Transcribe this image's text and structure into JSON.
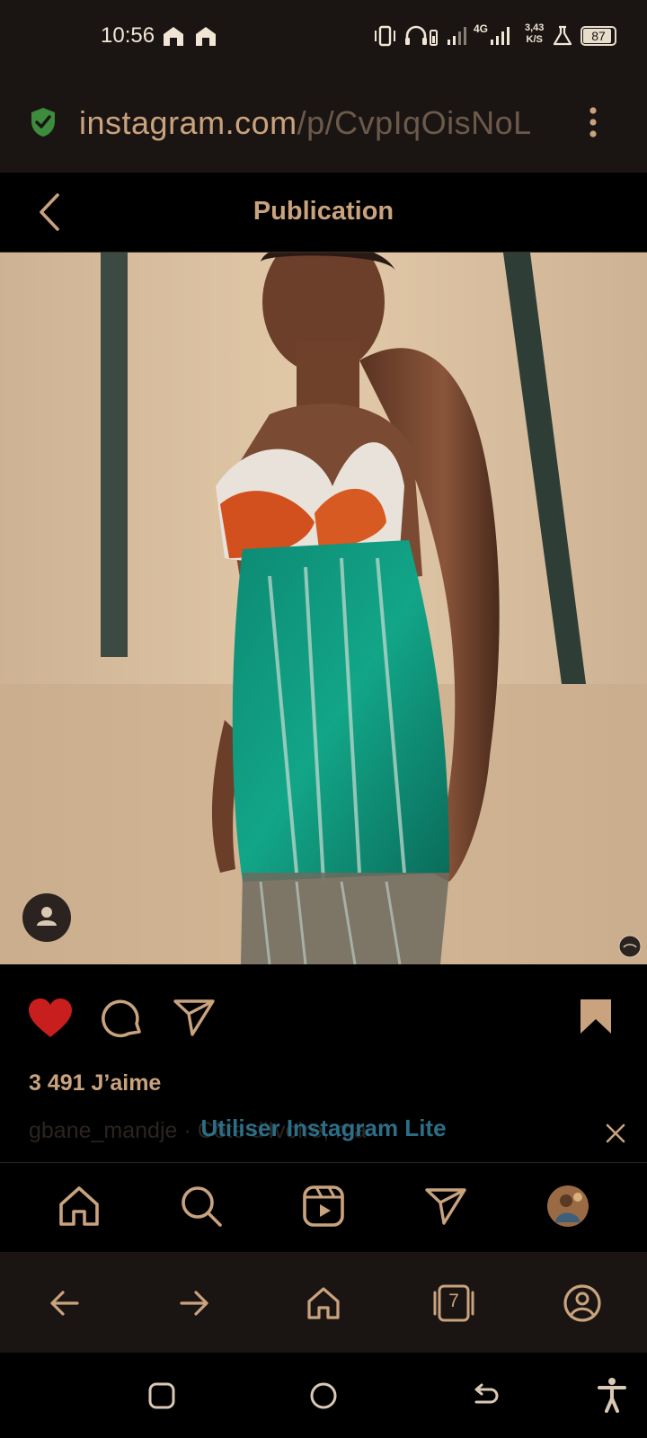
{
  "status_bar": {
    "time": "10:56",
    "net_type": "4G",
    "net_speed_value": "3,43",
    "net_speed_unit": "K/S",
    "battery": "87"
  },
  "browser": {
    "url_domain": "instagram.com",
    "url_path": "/p/CvpIqOisNoL"
  },
  "header": {
    "title": "Publication"
  },
  "post": {
    "likes": "3 491 J’aime",
    "caption": "gbane_mandje · Côte d'Ivoire, ma"
  },
  "banner": {
    "label": "Utiliser Instagram Lite"
  },
  "browser_toolbar": {
    "tab_count": "7"
  },
  "colors": {
    "accent": "#c9a27e",
    "like": "#c81e1e",
    "banner_link": "#2a6f87",
    "background": "#000000"
  }
}
